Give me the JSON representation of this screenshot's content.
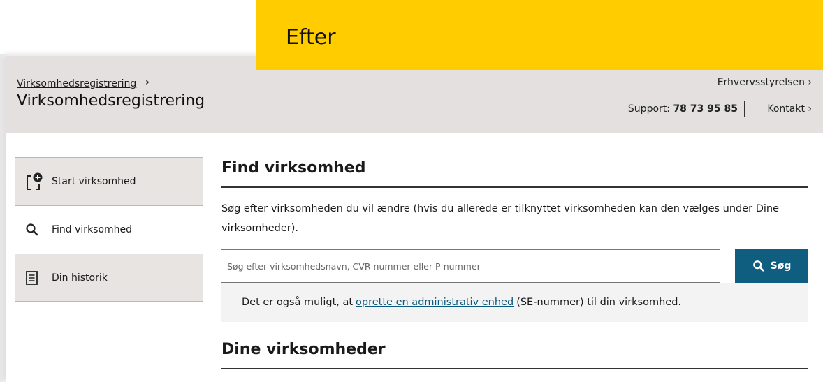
{
  "banner": {
    "label": "Efter",
    "color": "#ffcc00"
  },
  "header": {
    "breadcrumb": "Virksomhedsregistrering",
    "breadcrumb_chevron": "›",
    "title": "Virksomhedsregistrering",
    "org_link": "Erhvervsstyrelsen ›",
    "support_label": "Support:",
    "support_number": "78 73 95 85",
    "contact_link": "Kontakt ›"
  },
  "sidebar": {
    "items": [
      {
        "label": "Start virksomhed",
        "icon": "add-document-icon",
        "active": false
      },
      {
        "label": "Find virksomhed",
        "icon": "search-icon",
        "active": true
      },
      {
        "label": "Din historik",
        "icon": "document-list-icon",
        "active": false
      }
    ]
  },
  "main": {
    "find_heading": "Find virksomhed",
    "description": "Søg efter virksomheden du vil ændre (hvis du allerede er tilknyttet virksomheden kan den vælges under Dine virksomheder).",
    "search_placeholder": "Søg efter virksomhedsnavn, CVR-nummer eller P-nummer",
    "search_button": "Søg",
    "info_prefix": "Det er også muligt, at",
    "info_link": "oprette en administrativ enhed",
    "info_suffix": "(SE-nummer) til din virksomhed.",
    "companies_heading": "Dine virksomheder"
  },
  "colors": {
    "header_bg": "#e3e0df",
    "accent": "#0f5e80",
    "link": "#0b5a7c"
  }
}
